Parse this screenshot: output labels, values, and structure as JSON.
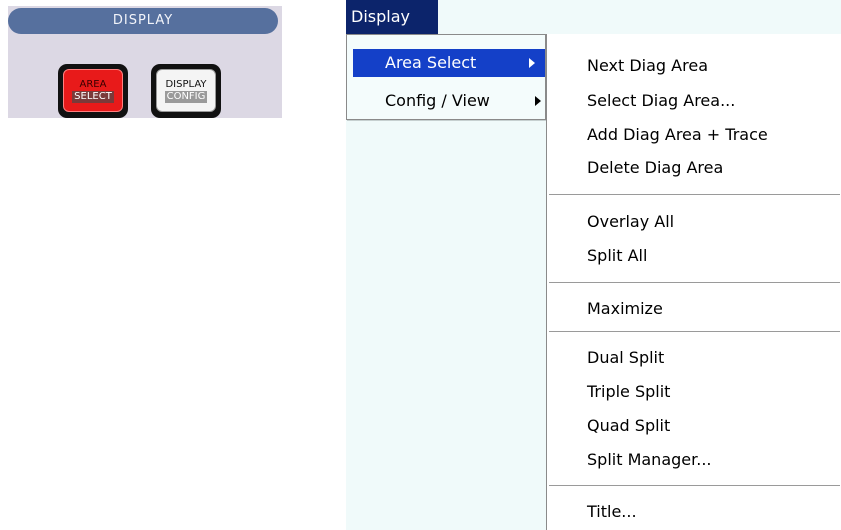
{
  "panel": {
    "title": "DISPLAY",
    "keys": [
      {
        "line1": "AREA",
        "line2": "SELECT"
      },
      {
        "line1": "DISPLAY",
        "line2": "CONFIG"
      }
    ]
  },
  "menubar": {
    "active_menu": "Display"
  },
  "dropdown": {
    "items": [
      {
        "label": "Area Select"
      },
      {
        "label": "Config / View"
      }
    ]
  },
  "submenu": {
    "items": [
      "Next Diag Area",
      "Select Diag Area...",
      "Add Diag Area + Trace",
      "Delete Diag Area",
      "Overlay All",
      "Split All",
      "Maximize",
      "Dual Split",
      "Triple Split",
      "Quad Split",
      "Split Manager...",
      "Title..."
    ]
  },
  "colors": {
    "menu_highlight": "#1440c8",
    "menubar_active": "#0c246b",
    "area_select_key": "#e81a1a",
    "panel_title_bar": "#56709e"
  }
}
